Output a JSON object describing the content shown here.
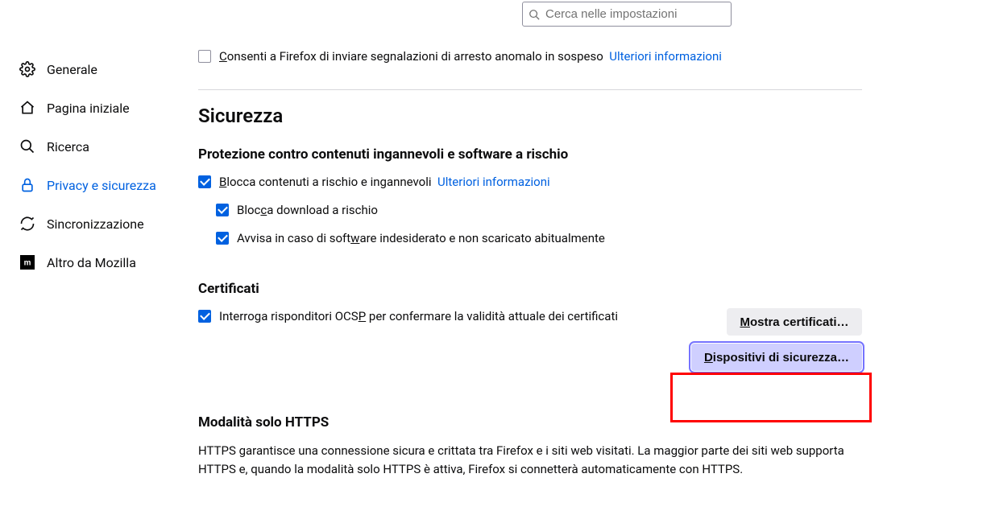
{
  "search": {
    "placeholder": "Cerca nelle impostazioni"
  },
  "sidebar": {
    "items": [
      {
        "label": "Generale"
      },
      {
        "label": "Pagina iniziale"
      },
      {
        "label": "Ricerca"
      },
      {
        "label": "Privacy e sicurezza"
      },
      {
        "label": "Sincronizzazione"
      },
      {
        "label": "Altro da Mozilla"
      }
    ]
  },
  "crash": {
    "pre": "C",
    "label": "onsenti a Firefox di inviare segnalazioni di arresto anomalo in sospeso",
    "learn": "Ulteriori informazioni"
  },
  "security": {
    "heading": "Sicurezza",
    "deceptive": {
      "heading": "Protezione contro contenuti ingannevoli e software a rischio",
      "block_pre": "B",
      "block": "locca contenuti a rischio e ingannevoli",
      "learn": "Ulteriori informazioni",
      "block_downloads_pre": "Bloc",
      "block_downloads_key": "c",
      "block_downloads_post": "a download a rischio",
      "warn_pre": "Avvisa in caso di soft",
      "warn_key": "w",
      "warn_post": "are indesiderato e non scaricato abitualmente"
    },
    "certs": {
      "heading": "Certificati",
      "ocsp_pre": "Interroga risponditori OCS",
      "ocsp_key": "P",
      "ocsp_post": " per confermare la validità attuale dei certificati",
      "show_pre": "M",
      "show_post": "ostra certificati…",
      "devices_pre": "D",
      "devices_post": "ispositivi di sicurezza…"
    },
    "https": {
      "heading": "Modalità solo HTTPS",
      "body": "HTTPS garantisce una connessione sicura e crittata tra Firefox e i siti web visitati. La maggior parte dei siti web supporta HTTPS e, quando la modalità solo HTTPS è attiva, Firefox si connetterà automaticamente con HTTPS."
    }
  }
}
